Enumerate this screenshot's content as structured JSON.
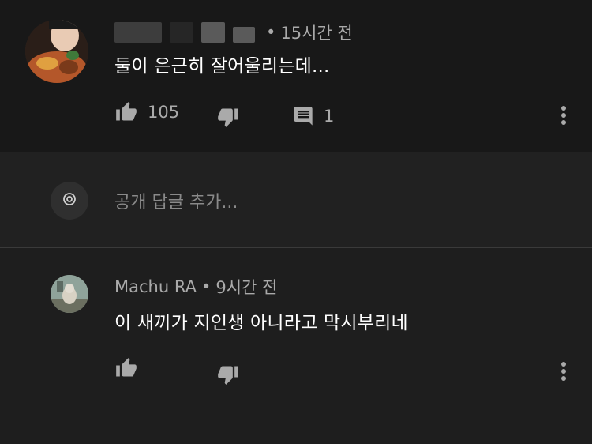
{
  "comments": [
    {
      "author": "",
      "time": "15시간 전",
      "text": "둘이 은근히 잘어울리는데...",
      "likes": "105",
      "replies": "1"
    },
    {
      "author": "Machu RA",
      "time": "9시간 전",
      "text": "이 새끼가 지인생 아니라고 막시부리네",
      "likes": "",
      "replies": ""
    }
  ],
  "meta_separator": "•",
  "reply_box": {
    "placeholder": "공개 답글 추가..."
  },
  "icons": {
    "like": "thumbs-up-icon",
    "dislike": "thumbs-down-icon",
    "reply": "comment-icon",
    "more": "more-vertical-icon"
  },
  "colors": {
    "background": "#181818",
    "text_primary": "#ffffff",
    "text_secondary": "#aaaaaa"
  }
}
